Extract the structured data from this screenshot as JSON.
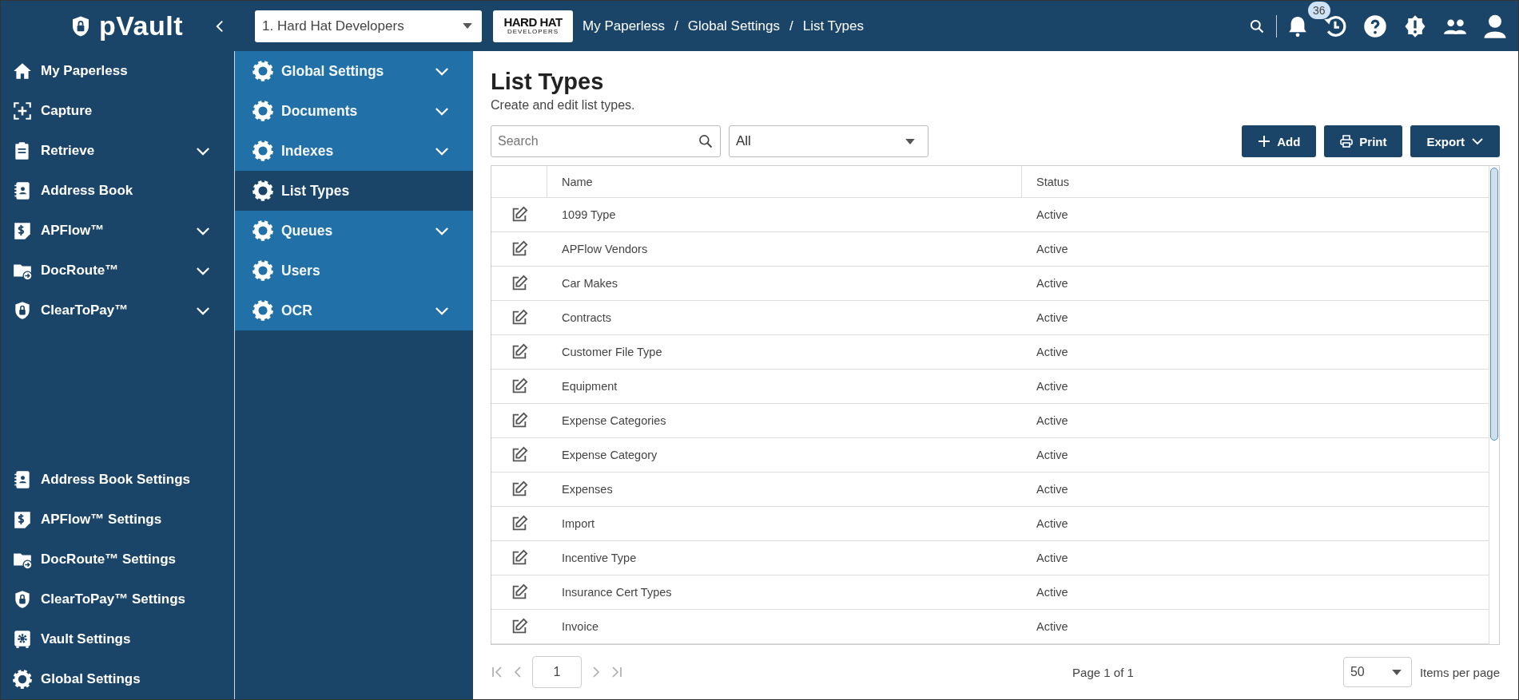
{
  "app": {
    "logo": "pVault",
    "company_select": {
      "value": "1. Hard Hat Developers"
    },
    "company_logo": {
      "line1": "HARD HAT",
      "line2": "DEVELOPERS"
    },
    "breadcrumb": {
      "links": [
        "My Paperless",
        "Global Settings",
        "List Types"
      ],
      "separators": [
        "/",
        "/"
      ]
    },
    "notifications": {
      "count": "36"
    }
  },
  "sidebar": {
    "items": [
      {
        "kind": "home",
        "label": "My Paperless",
        "expandable": false
      },
      {
        "kind": "capture",
        "label": "Capture",
        "expandable": false
      },
      {
        "kind": "retrieve",
        "label": "Retrieve",
        "expandable": true
      },
      {
        "kind": "addressbook",
        "label": "Address Book",
        "expandable": false
      },
      {
        "kind": "apflow",
        "label": "APFlow™",
        "expandable": true
      },
      {
        "kind": "docroute",
        "label": "DocRoute™",
        "expandable": true
      },
      {
        "kind": "cleartopay",
        "label": "ClearToPay™",
        "expandable": true
      }
    ],
    "settings_items": [
      {
        "kind": "addressbook",
        "label": "Address Book Settings"
      },
      {
        "kind": "apflow",
        "label": "APFlow™ Settings"
      },
      {
        "kind": "docroute",
        "label": "DocRoute™ Settings"
      },
      {
        "kind": "cleartopay",
        "label": "ClearToPay™ Settings"
      },
      {
        "kind": "vault",
        "label": "Vault Settings"
      },
      {
        "kind": "gear",
        "label": "Global Settings"
      }
    ]
  },
  "submenu": {
    "items": [
      {
        "label": "Global Settings",
        "expandable": true,
        "selected": false
      },
      {
        "label": "Documents",
        "expandable": true,
        "selected": false
      },
      {
        "label": "Indexes",
        "expandable": true,
        "selected": false
      },
      {
        "label": "List Types",
        "expandable": false,
        "selected": true
      },
      {
        "label": "Queues",
        "expandable": true,
        "selected": false
      },
      {
        "label": "Users",
        "expandable": false,
        "selected": false
      },
      {
        "label": "OCR",
        "expandable": true,
        "selected": false
      }
    ]
  },
  "page": {
    "title": "List Types",
    "subtitle": "Create and edit list types.",
    "search": {
      "placeholder": "Search"
    },
    "filter": {
      "value": "All"
    },
    "buttons": [
      {
        "kind": "add",
        "label": "Add"
      },
      {
        "kind": "print",
        "label": "Print"
      },
      {
        "kind": "export",
        "label": "Export"
      }
    ]
  },
  "table": {
    "columns": [
      "Name",
      "Status"
    ],
    "rows": [
      {
        "name": "1099 Type",
        "status": "Active"
      },
      {
        "name": "APFlow Vendors",
        "status": "Active"
      },
      {
        "name": "Car Makes",
        "status": "Active"
      },
      {
        "name": "Contracts",
        "status": "Active"
      },
      {
        "name": "Customer File Type",
        "status": "Active"
      },
      {
        "name": "Equipment",
        "status": "Active"
      },
      {
        "name": "Expense Categories",
        "status": "Active"
      },
      {
        "name": "Expense Category",
        "status": "Active"
      },
      {
        "name": "Expenses",
        "status": "Active"
      },
      {
        "name": "Import",
        "status": "Active"
      },
      {
        "name": "Incentive Type",
        "status": "Active"
      },
      {
        "name": "Insurance Cert Types",
        "status": "Active"
      },
      {
        "name": "Invoice",
        "status": "Active"
      }
    ]
  },
  "pagination": {
    "page": "1",
    "summary": "Page 1 of 1",
    "per_page": "50",
    "per_page_label": "Items per page"
  }
}
